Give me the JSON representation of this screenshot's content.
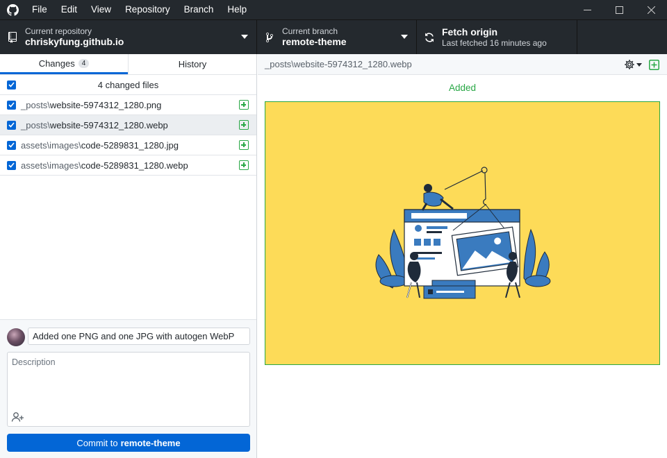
{
  "menu": [
    "File",
    "Edit",
    "View",
    "Repository",
    "Branch",
    "Help"
  ],
  "toolbar": {
    "repo": {
      "sub": "Current repository",
      "main": "chriskyfung.github.io"
    },
    "branch": {
      "sub": "Current branch",
      "main": "remote-theme"
    },
    "fetch": {
      "main": "Fetch origin",
      "sub": "Last fetched 16 minutes ago"
    }
  },
  "tabs": {
    "changes": "Changes",
    "changes_count": "4",
    "history": "History"
  },
  "changes_header": "4 changed files",
  "files": [
    {
      "dir": "_posts\\",
      "name": "website-5974312_1280.png"
    },
    {
      "dir": "_posts\\",
      "name": "website-5974312_1280.webp"
    },
    {
      "dir": "assets\\images\\",
      "name": "code-5289831_1280.jpg"
    },
    {
      "dir": "assets\\images\\",
      "name": "code-5289831_1280.webp"
    }
  ],
  "commit": {
    "summary": "Added one PNG and one JPG with autogen WebP",
    "description_placeholder": "Description",
    "button_prefix": "Commit to",
    "button_branch": "remote-theme"
  },
  "diff": {
    "path": "_posts\\website-5974312_1280.webp",
    "status": "Added"
  },
  "colors": {
    "accent": "#0366d6",
    "added": "#28a745",
    "chrome": "#24292e",
    "image_bg": "#fddb58"
  }
}
